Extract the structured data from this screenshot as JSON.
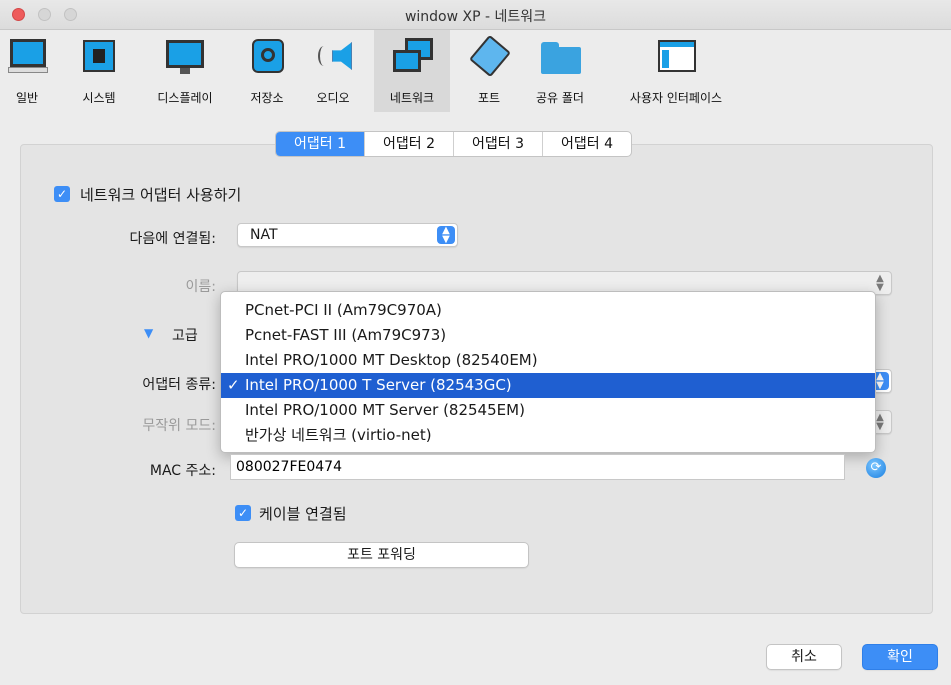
{
  "window": {
    "title": "window XP - 네트워크"
  },
  "toolbar": {
    "items": [
      {
        "label": "일반",
        "icon": "general-icon"
      },
      {
        "label": "시스템",
        "icon": "system-chip-icon"
      },
      {
        "label": "디스플레이",
        "icon": "display-monitor-icon"
      },
      {
        "label": "저장소",
        "icon": "storage-disk-icon"
      },
      {
        "label": "오디오",
        "icon": "audio-speaker-icon"
      },
      {
        "label": "네트워크",
        "icon": "network-icon"
      },
      {
        "label": "포트",
        "icon": "port-icon"
      },
      {
        "label": "공유 폴더",
        "icon": "shared-folder-icon"
      },
      {
        "label": "사용자 인터페이스",
        "icon": "user-interface-icon"
      }
    ],
    "selected": "네트워크"
  },
  "tabs": [
    {
      "label": "어댑터 1",
      "active": true
    },
    {
      "label": "어댑터 2",
      "active": false
    },
    {
      "label": "어댑터 3",
      "active": false
    },
    {
      "label": "어댑터 4",
      "active": false
    }
  ],
  "form": {
    "enable_adapter_label": "네트워크 어댑터 사용하기",
    "attached_to_label": "다음에 연결됨:",
    "attached_to_value": "NAT",
    "name_label": "이름:",
    "name_value": "",
    "advanced_label": "고급",
    "adapter_type_label": "어댑터 종류:",
    "promiscuous_label": "무작위 모드:",
    "mac_label": "MAC 주소:",
    "mac_value": "080027FE0474",
    "cable_connected_label": "케이블 연결됨",
    "port_forwarding_label": "포트 포워딩"
  },
  "adapter_type_options": [
    {
      "label": "PCnet-PCI II (Am79C970A)",
      "selected": false
    },
    {
      "label": "Pcnet-FAST III (Am79C973)",
      "selected": false
    },
    {
      "label": "Intel PRO/1000 MT Desktop (82540EM)",
      "selected": false
    },
    {
      "label": "Intel PRO/1000 T Server (82543GC)",
      "selected": true
    },
    {
      "label": "Intel PRO/1000 MT Server (82545EM)",
      "selected": false
    },
    {
      "label": "반가상 네트워크 (virtio-net)",
      "selected": false
    }
  ],
  "footer": {
    "cancel_label": "취소",
    "ok_label": "확인"
  },
  "colors": {
    "accent": "#3d8ef6",
    "selection": "#1f5fd1"
  }
}
